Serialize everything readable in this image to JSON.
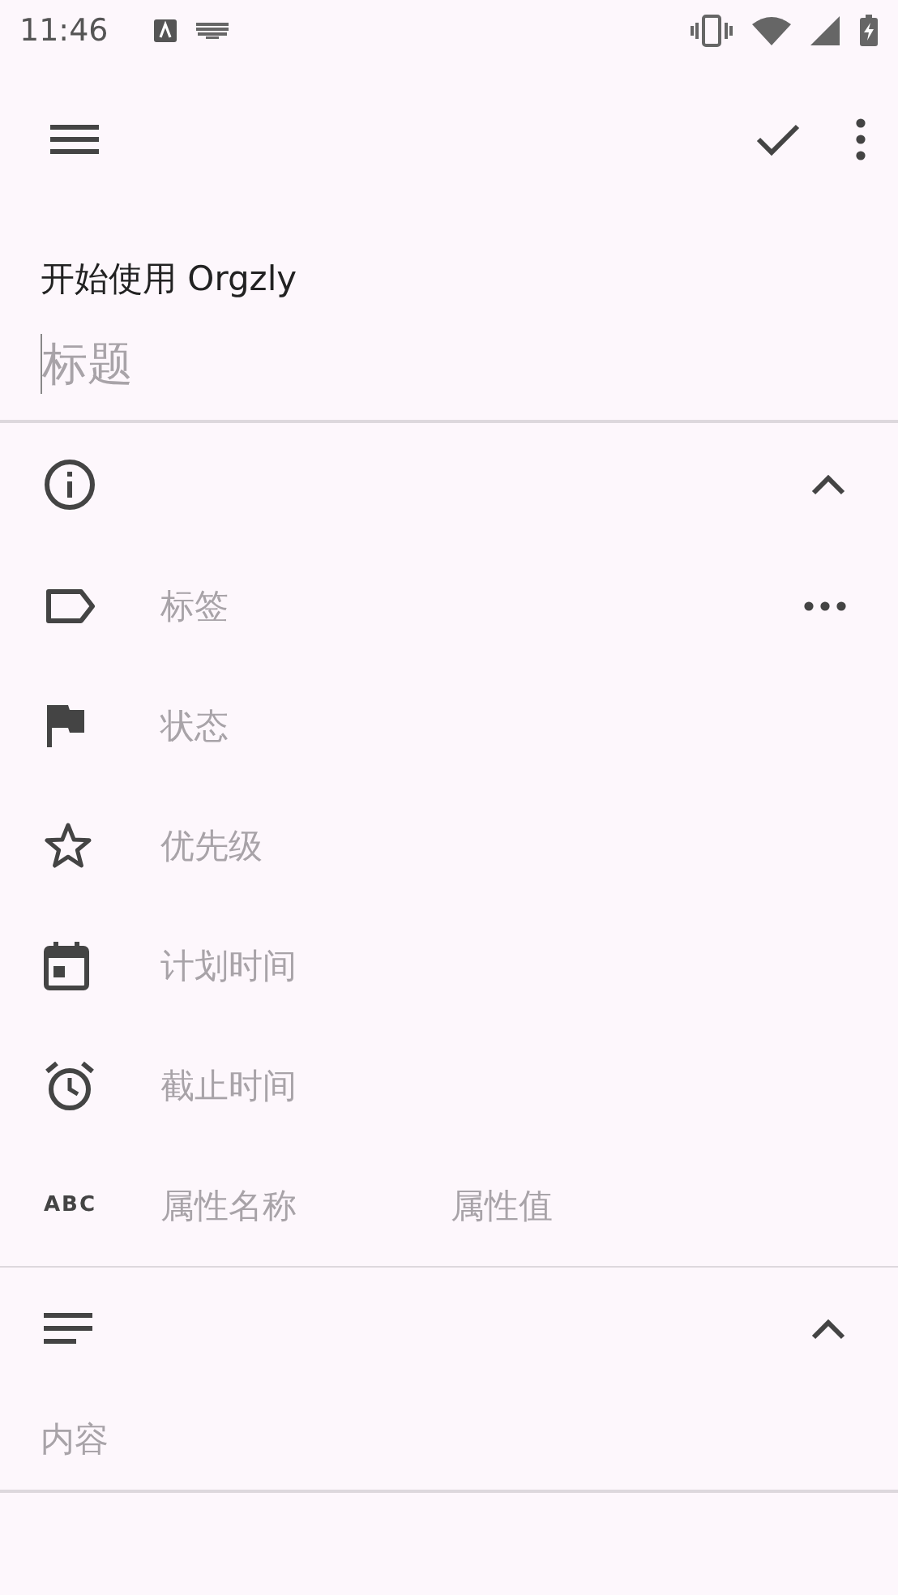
{
  "status_bar": {
    "time": "11:46"
  },
  "book": "开始使用 Orgzly",
  "title_field": {
    "placeholder": "标题"
  },
  "info_section": {
    "expanded": true,
    "rows": [
      {
        "kind": "tags",
        "placeholder": "标签"
      },
      {
        "kind": "state",
        "placeholder": "状态"
      },
      {
        "kind": "priority",
        "placeholder": "优先级"
      },
      {
        "kind": "scheduled",
        "placeholder": "计划时间"
      },
      {
        "kind": "deadline",
        "placeholder": "截止时间"
      },
      {
        "kind": "property",
        "icon_text": "ABC",
        "placeholder": "属性名称",
        "value_placeholder": "属性值"
      }
    ]
  },
  "content_section": {
    "expanded": true,
    "placeholder": "内容"
  }
}
